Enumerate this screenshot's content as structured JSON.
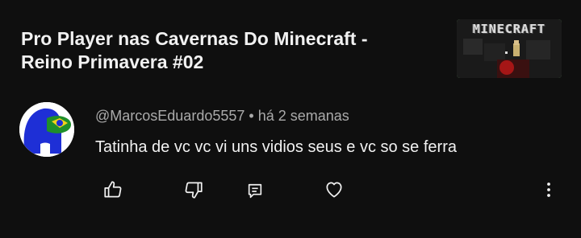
{
  "video": {
    "title": "Pro Player nas Cavernas Do Minecraft -\nReino Primavera #02",
    "thumbnail_text": "MINECRAFT"
  },
  "comment": {
    "author": "@MarcosEduardo5557",
    "separator": "•",
    "time": "há 2 semanas",
    "text": "Tatinha de vc vc vi uns vidios seus e vc so se ferra"
  },
  "actions": {
    "like_icon": "thumbs-up-icon",
    "dislike_icon": "thumbs-down-icon",
    "reply_icon": "reply-icon",
    "heart_icon": "heart-icon",
    "more_icon": "more-vertical-icon"
  },
  "colors": {
    "background": "#0f0f0f",
    "text_primary": "#f1f1f1",
    "text_secondary": "#aaaaaa"
  }
}
